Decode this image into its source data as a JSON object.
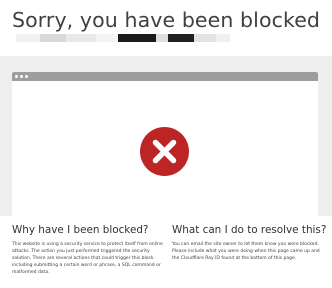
{
  "page": {
    "title": "Sorry, you have been blocked"
  },
  "redacted_subtitle": {
    "colors": [
      "#f1f1f1",
      "#d9d9d9",
      "#e9e9e9",
      "#f4f4f4",
      "#1b1b1b",
      "#dedede",
      "#222222",
      "#e3e3e3",
      "#f0f0f0"
    ]
  },
  "browser_graphic": {
    "bar_color": "#9e9e9e",
    "icon": "blocked-x-icon",
    "icon_color": "#bd2426"
  },
  "why_blocked": {
    "heading": "Why have I been blocked?",
    "text": "This website is using a security service to protect itself from online attacks. The action you just performed triggered the security solution. There are several actions that could trigger this block including submitting a certain word or phrase, a SQL command or malformed data."
  },
  "resolve": {
    "heading": "What can I do to resolve this?",
    "text": "You can email the site owner to let them know you were blocked. Please include what you were doing when this page came up and the Cloudflare Ray ID found at the bottom of this page."
  }
}
